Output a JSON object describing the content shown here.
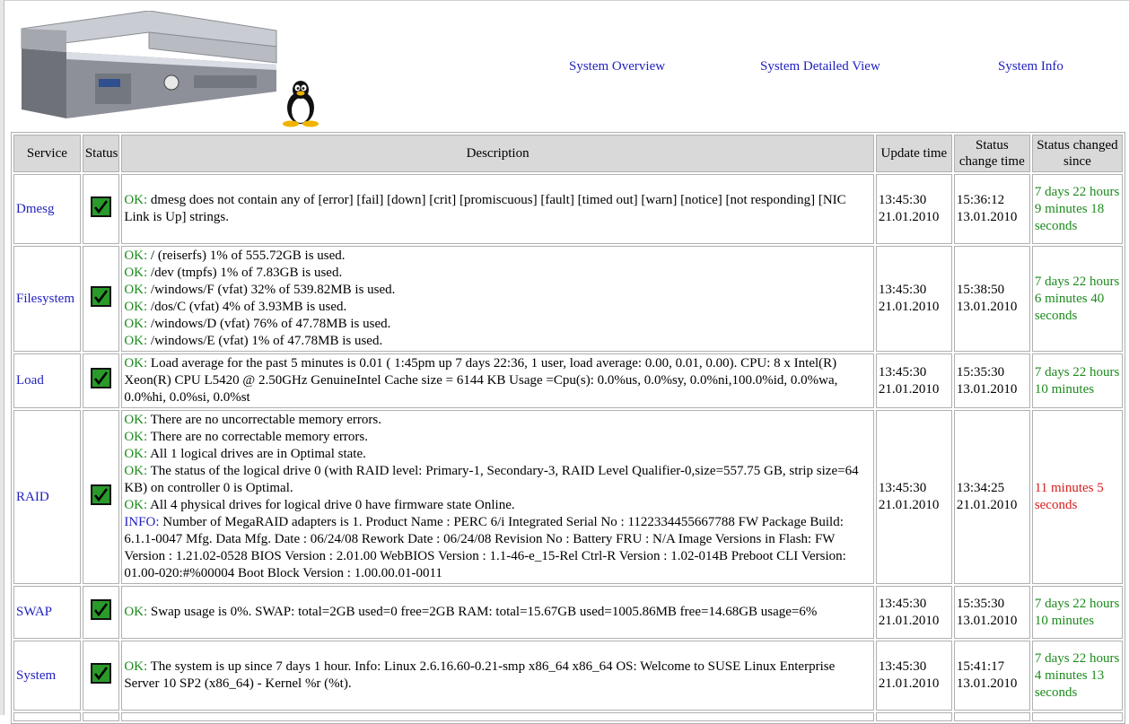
{
  "nav": {
    "overview": "System Overview",
    "detailed": "System Detailed View",
    "info": "System Info"
  },
  "table": {
    "headers": {
      "service": "Service",
      "status": "Status",
      "description": "Description",
      "update_time": "Update time",
      "status_change_time": "Status change time",
      "status_changed_since": "Status changed since"
    },
    "rows": [
      {
        "service": "Dmesg",
        "status": "ok",
        "lines": [
          {
            "level": "OK:",
            "text": " dmesg does not contain any of [error] [fail] [down] [crit] [promiscuous] [fault] [timed out] [warn] [notice] [not responding] [NIC Link is Up] strings."
          }
        ],
        "update_time": "13:45:30",
        "update_date": "21.01.2010",
        "change_time": "15:36:12",
        "change_date": "13.01.2010",
        "since": "7 days 22 hours 9 minutes 18 seconds",
        "since_color": "green"
      },
      {
        "service": "Filesystem",
        "status": "ok",
        "lines": [
          {
            "level": "OK:",
            "text": " / (reiserfs) 1% of 555.72GB is used."
          },
          {
            "level": "OK:",
            "text": " /dev (tmpfs) 1% of 7.83GB is used."
          },
          {
            "level": "OK:",
            "text": " /windows/F (vfat) 32% of 539.82MB is used."
          },
          {
            "level": "OK:",
            "text": " /dos/C (vfat) 4% of 3.93MB is used."
          },
          {
            "level": "OK:",
            "text": " /windows/D (vfat) 76% of 47.78MB is used."
          },
          {
            "level": "OK:",
            "text": " /windows/E (vfat) 1% of 47.78MB is used."
          }
        ],
        "update_time": "13:45:30",
        "update_date": "21.01.2010",
        "change_time": "15:38:50",
        "change_date": "13.01.2010",
        "since": "7 days 22 hours 6 minutes 40 seconds",
        "since_color": "green"
      },
      {
        "service": "Load",
        "status": "ok",
        "lines": [
          {
            "level": "OK:",
            "text": " Load average for the past 5 minutes is 0.01 ( 1:45pm up 7 days 22:36, 1 user, load average: 0.00, 0.01, 0.00). CPU: 8 x Intel(R) Xeon(R) CPU L5420 @ 2.50GHz GenuineIntel Cache size = 6144 KB Usage =Cpu(s): 0.0%us, 0.0%sy, 0.0%ni,100.0%id, 0.0%wa, 0.0%hi, 0.0%si, 0.0%st"
          }
        ],
        "update_time": "13:45:30",
        "update_date": "21.01.2010",
        "change_time": "15:35:30",
        "change_date": "13.01.2010",
        "since": "7 days 22 hours 10 minutes",
        "since_color": "green"
      },
      {
        "service": "RAID",
        "status": "ok",
        "lines": [
          {
            "level": "OK:",
            "text": " There are no uncorrectable memory errors."
          },
          {
            "level": "OK:",
            "text": " There are no correctable memory errors."
          },
          {
            "level": "OK:",
            "text": " All 1 logical drives are in Optimal state."
          },
          {
            "level": "OK:",
            "text": " The status of the logical drive 0 (with RAID level: Primary-1, Secondary-3, RAID Level Qualifier-0,size=557.75 GB, strip size=64 KB) on controller 0 is Optimal."
          },
          {
            "level": "OK:",
            "text": " All 4 physical drives for logical drive 0 have firmware state Online."
          },
          {
            "level": "INFO:",
            "text": " Number of MegaRAID adapters is 1. Product Name : PERC 6/i Integrated Serial No : 1122334455667788 FW Package Build: 6.1.1-0047 Mfg. Data Mfg. Date : 06/24/08 Rework Date : 06/24/08 Revision No : Battery FRU : N/A Image Versions in Flash: FW Version : 1.21.02-0528 BIOS Version : 2.01.00 WebBIOS Version : 1.1-46-e_15-Rel Ctrl-R Version : 1.02-014B Preboot CLI Version: 01.00-020:#%00004 Boot Block Version : 1.00.00.01-0011"
          }
        ],
        "update_time": "13:45:30",
        "update_date": "21.01.2010",
        "change_time": "13:34:25",
        "change_date": "21.01.2010",
        "since": "11 minutes 5 seconds",
        "since_color": "red"
      },
      {
        "service": "SWAP",
        "status": "ok",
        "lines": [
          {
            "level": "OK:",
            "text": " Swap usage is 0%. SWAP: total=2GB used=0 free=2GB RAM: total=15.67GB used=1005.86MB free=14.68GB usage=6%"
          }
        ],
        "update_time": "13:45:30",
        "update_date": "21.01.2010",
        "change_time": "15:35:30",
        "change_date": "13.01.2010",
        "since": "7 days 22 hours 10 minutes",
        "since_color": "green"
      },
      {
        "service": "System",
        "status": "ok",
        "lines": [
          {
            "level": "OK:",
            "text": " The system is up since 7 days 1 hour. Info: Linux 2.6.16.60-0.21-smp x86_64 x86_64 OS: Welcome to SUSE Linux Enterprise Server 10 SP2 (x86_64) - Kernel %r (%t)."
          }
        ],
        "update_time": "13:45:30",
        "update_date": "21.01.2010",
        "change_time": "15:41:17",
        "change_date": "13.01.2010",
        "since": "7 days 22 hours 4 minutes 13 seconds",
        "since_color": "green"
      }
    ]
  }
}
